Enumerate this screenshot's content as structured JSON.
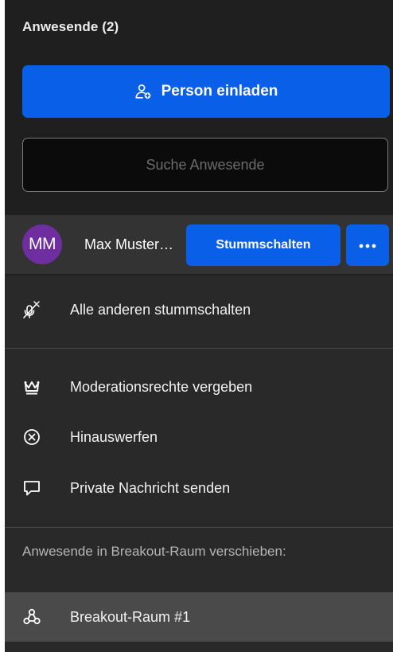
{
  "header": {
    "title": "Anwesende (2)"
  },
  "invite_button": {
    "label": "Person einladen",
    "icon": "add-person-icon"
  },
  "search": {
    "placeholder": "Suche Anwesende",
    "value": ""
  },
  "participant": {
    "initials": "MM",
    "avatar_color": "#6e2ea0",
    "name": "Max Mustermann",
    "mute_label": "Stummschalten",
    "more_icon": "more-dots-icon"
  },
  "menu": {
    "items": [
      {
        "label": "Alle anderen stummschalten",
        "icon": "mute-all-icon"
      },
      {
        "label": "Moderationsrechte vergeben",
        "icon": "crown-icon"
      },
      {
        "label": "Hinauswerfen",
        "icon": "kick-circle-x-icon"
      },
      {
        "label": "Private Nachricht senden",
        "icon": "message-bubble-icon"
      }
    ],
    "breakout_section_label": "Anwesende in Breakout-Raum verschieben:",
    "breakout_rooms": [
      {
        "label": "Breakout-Raum #1",
        "icon": "breakout-room-icon"
      }
    ]
  },
  "colors": {
    "accent": "#0a5fe8",
    "panel_bg": "#1f1f1f",
    "menu_bg": "#292929"
  }
}
